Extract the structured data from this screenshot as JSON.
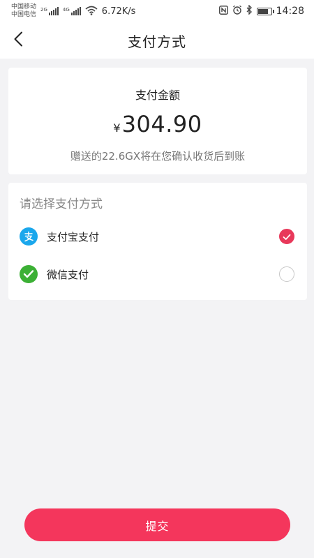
{
  "status_bar": {
    "carrier_1": "中国移动",
    "carrier_2": "中国电信",
    "sim1_tag": "2G",
    "sim2_tag": "4G",
    "net_speed": "6.72K/s",
    "time": "14:28",
    "battery_level": 0.8,
    "icons": [
      "signal-icon",
      "wifi-icon",
      "nfc-icon",
      "alarm-icon",
      "bluetooth-icon",
      "battery-icon"
    ]
  },
  "header": {
    "title": "支付方式",
    "back_icon": "chevron-left-icon"
  },
  "amount_card": {
    "label": "支付金额",
    "currency": "¥",
    "amount": "304.90",
    "note": "赠送的22.6GX将在您确认收货后到账"
  },
  "payment_methods": {
    "heading": "请选择支付方式",
    "items": [
      {
        "name": "支付宝支付",
        "icon": "alipay-icon",
        "selected": true
      },
      {
        "name": "微信支付",
        "icon": "wechat-icon",
        "selected": false
      }
    ]
  },
  "submit": {
    "label": "提交"
  },
  "colors": {
    "accent": "#f4365c",
    "checked": "#e8385a",
    "alipay": "#1aa7ec",
    "wechat": "#3cb035",
    "background": "#f3f3f5"
  }
}
